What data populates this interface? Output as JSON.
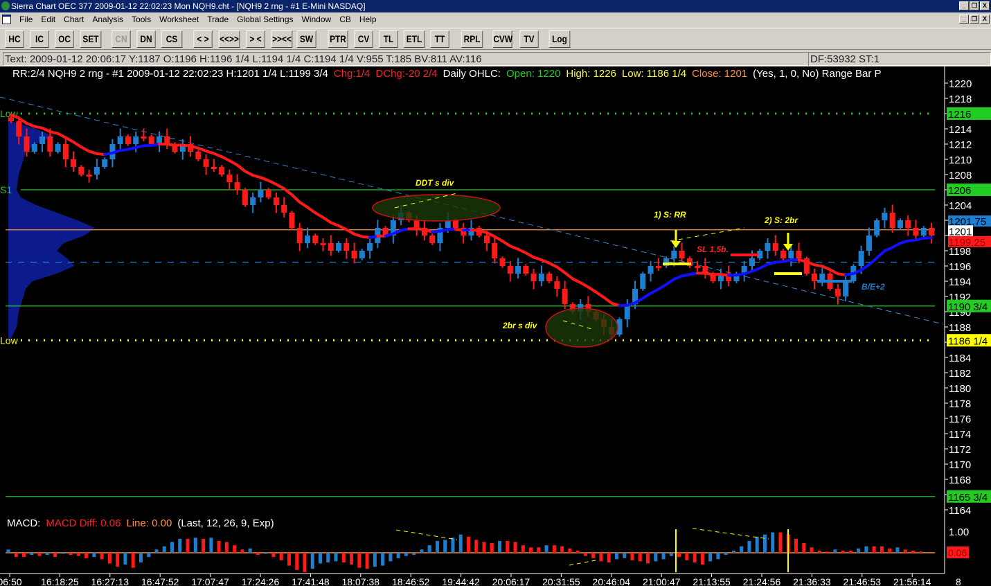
{
  "window": {
    "title": "Sierra Chart OEC 377  2009-01-12  22:02:23  Mon   NQH9.cht - [NQH9  2 rng - #1 E-Mini NASDAQ]",
    "min": "_",
    "restore": "❐",
    "close": "X"
  },
  "menu": [
    "File",
    "Edit",
    "Chart",
    "Analysis",
    "Tools",
    "Worksheet",
    "Trade",
    "Global Settings",
    "Window",
    "CB",
    "Help"
  ],
  "toolbar": [
    {
      "l": "HC"
    },
    {
      "l": "IC"
    },
    {
      "l": "OC"
    },
    {
      "l": "SET"
    },
    {
      "l": "CN",
      "disabled": true
    },
    {
      "l": "DN"
    },
    {
      "l": "CS"
    },
    {
      "l": "< >"
    },
    {
      "l": "<<>>"
    },
    {
      "l": "> <"
    },
    {
      "l": ">><<"
    },
    {
      "l": "SW"
    },
    {
      "l": "PTR"
    },
    {
      "l": "CV"
    },
    {
      "l": "TL"
    },
    {
      "l": "ETL"
    },
    {
      "l": "TT"
    },
    {
      "l": "RPL"
    },
    {
      "l": "CVW"
    },
    {
      "l": "TV"
    },
    {
      "l": "Log"
    }
  ],
  "infobar": {
    "text": "Text: 2009-01-12  20:06:17  Y:1187  O:1196  H:1196 1/4  L:1194 1/4  C:1194 1/4  V:955  T:185  BV:811  AV:116",
    "df": "DF:53932  ST:1"
  },
  "header": {
    "main": "RR:2/4  NQH9  2 rng - #1  2009-01-12  22:02:23  H:1201 1/4  L:1199 3/4",
    "chg": "Chg:1/4",
    "dchg": "DChg:-20 2/4",
    "daily": "Daily OHLC:",
    "open": "Open: 1220",
    "high": "High: 1226",
    "low": "Low: 1186 1/4",
    "close": "Close: 1201",
    "params": "(Yes, 1, 0, No)  Range Bar P"
  },
  "macd_header": {
    "label": "MACD:",
    "diff": "MACD Diff: 0.06",
    "line": "Line: 0.00",
    "params": "(Last, 12, 26, 9, Exp)"
  },
  "colors": {
    "up": "#1e7fd0",
    "down": "#ff1a1a",
    "ema": "#ff1a1a",
    "ema_up": "#1010ff",
    "green": "#22cc22",
    "yellow": "#ffff00",
    "orange": "#ff9040",
    "profile": "#0c1a8c"
  },
  "chart_data": {
    "type": "candlestick",
    "price_axis": {
      "min": 1164,
      "max": 1220,
      "ticks": [
        1220,
        1218,
        1216,
        1214,
        1212,
        1210,
        1208,
        1206,
        1204,
        1202,
        1200,
        1198,
        1196,
        1194,
        1192,
        1190,
        1188,
        1186,
        1184,
        1182,
        1180,
        1178,
        1176,
        1174,
        1172,
        1170,
        1168,
        1166,
        1164
      ]
    },
    "closes": [
      1215,
      1213,
      1211,
      1212,
      1213,
      1211,
      1212,
      1210,
      1209,
      1208,
      1208,
      1209,
      1210,
      1212,
      1213,
      1212,
      1213,
      1213,
      1212,
      1213,
      1212,
      1211,
      1212,
      1211,
      1210,
      1209,
      1209,
      1208,
      1207,
      1206,
      1204,
      1205,
      1206,
      1205,
      1204,
      1203,
      1201,
      1199,
      1200,
      1199,
      1199,
      1198,
      1199,
      1198,
      1197,
      1198,
      1199,
      1201,
      1200,
      1202,
      1203,
      1202,
      1201,
      1200,
      1199,
      1201,
      1202,
      1201,
      1200,
      1201,
      1200,
      1199,
      1197,
      1196,
      1195,
      1196,
      1195,
      1194,
      1195,
      1194,
      1193,
      1191,
      1190,
      1191,
      1190,
      1189,
      1188,
      1187,
      1189,
      1191,
      1193,
      1195,
      1196,
      1196,
      1197,
      1198,
      1197,
      1196,
      1196,
      1195,
      1194,
      1195,
      1194,
      1195,
      1196,
      1197,
      1198,
      1199,
      1198,
      1197,
      1198,
      1197,
      1195,
      1194,
      1195,
      1193,
      1192,
      1194,
      1196,
      1198,
      1200,
      1202,
      1203,
      1201,
      1202,
      1201,
      1200,
      1201,
      1200
    ],
    "levels": [
      {
        "price": 1216,
        "label": "1216",
        "name": "Low",
        "style": "dotted",
        "color": "#22cc22"
      },
      {
        "price": 1206,
        "label": "1206",
        "name": "S1",
        "style": "solid",
        "color": "#22cc22"
      },
      {
        "price": 1190.75,
        "label": "1190 3/4",
        "style": "solid",
        "color": "#22cc22"
      },
      {
        "price": 1186.25,
        "label": "1186 1/4",
        "name": "Low",
        "style": "dotted",
        "color": "#ffff00"
      },
      {
        "price": 1165.75,
        "label": "1165 3/4",
        "style": "solid",
        "color": "#22cc22"
      },
      {
        "price": 1200.75,
        "style": "solid",
        "color": "#ff9040"
      },
      {
        "price": 1196.5,
        "style": "dashed",
        "color": "#1e7fd0"
      }
    ],
    "price_markers": [
      {
        "label": "1201.75",
        "bg": "#1e7fd0",
        "fg": "#000",
        "price": 1201.9
      },
      {
        "label": "1201",
        "bg": "#ffffff",
        "fg": "#000",
        "price": 1200.6
      },
      {
        "label": "1199.25",
        "bg": "#ff1a1a",
        "fg": "#900",
        "price": 1199.2
      }
    ],
    "annotations": [
      "DDT s div",
      "2br s div",
      "1) S: RR",
      "2) S: 2br",
      "SL 1,5b.",
      "B/E+2"
    ],
    "macd": {
      "axis_label": "1.00",
      "current": "0.06",
      "hist": [
        0.15,
        -0.2,
        -0.2,
        -0.1,
        -0.15,
        -0.1,
        -0.2,
        -0.05,
        -0.1,
        -0.15,
        -0.25,
        -0.2,
        -0.3,
        -0.5,
        -0.65,
        -0.55,
        -0.7,
        -0.45,
        -0.2,
        0.15,
        0.3,
        0.5,
        0.65,
        0.65,
        0.7,
        0.65,
        0.7,
        0.55,
        0.5,
        0.35,
        0.15,
        0.2,
        -0.1,
        -0.05,
        -0.2,
        -0.35,
        -0.6,
        -0.8,
        -0.9,
        -0.75,
        -0.5,
        -0.45,
        -0.4,
        -0.45,
        -0.55,
        -0.7,
        -0.75,
        -0.65,
        -0.6,
        -0.4,
        -0.25,
        -0.15,
        -0.1,
        0.15,
        0.35,
        0.55,
        0.6,
        0.7,
        0.85,
        0.75,
        0.6,
        0.5,
        0.45,
        0.55,
        0.55,
        0.5,
        0.35,
        0.25,
        0.25,
        0.35,
        0.35,
        0.3,
        0.2,
        0.1,
        -0.15,
        -0.25,
        -0.4,
        -0.45,
        -0.3,
        -0.25,
        -0.35,
        -0.4,
        -0.5,
        -0.4,
        -0.3,
        -0.15,
        -0.2,
        -0.35,
        -0.45,
        -0.55,
        -0.4,
        -0.3,
        -0.1,
        0.1,
        0.3,
        0.55,
        0.75,
        0.85,
        0.95,
        0.95,
        0.85,
        0.65,
        0.45,
        0.25,
        0.1,
        0.05,
        0.15,
        0.1,
        0.1,
        0.2,
        0.3,
        0.3,
        0.3,
        0.2,
        0.25,
        0.15,
        0.1,
        0.06
      ]
    },
    "time_labels": [
      "06:50",
      "16:18:25",
      "16:27:13",
      "16:47:52",
      "17:07:47",
      "17:24:26",
      "17:41:48",
      "18:07:38",
      "18:46:52",
      "19:44:42",
      "20:06:17",
      "20:31:55",
      "20:46:04",
      "21:00:47",
      "21:13:55",
      "21:24:56",
      "21:36:33",
      "21:46:53",
      "21:56:14"
    ],
    "axis_corner": "8"
  }
}
